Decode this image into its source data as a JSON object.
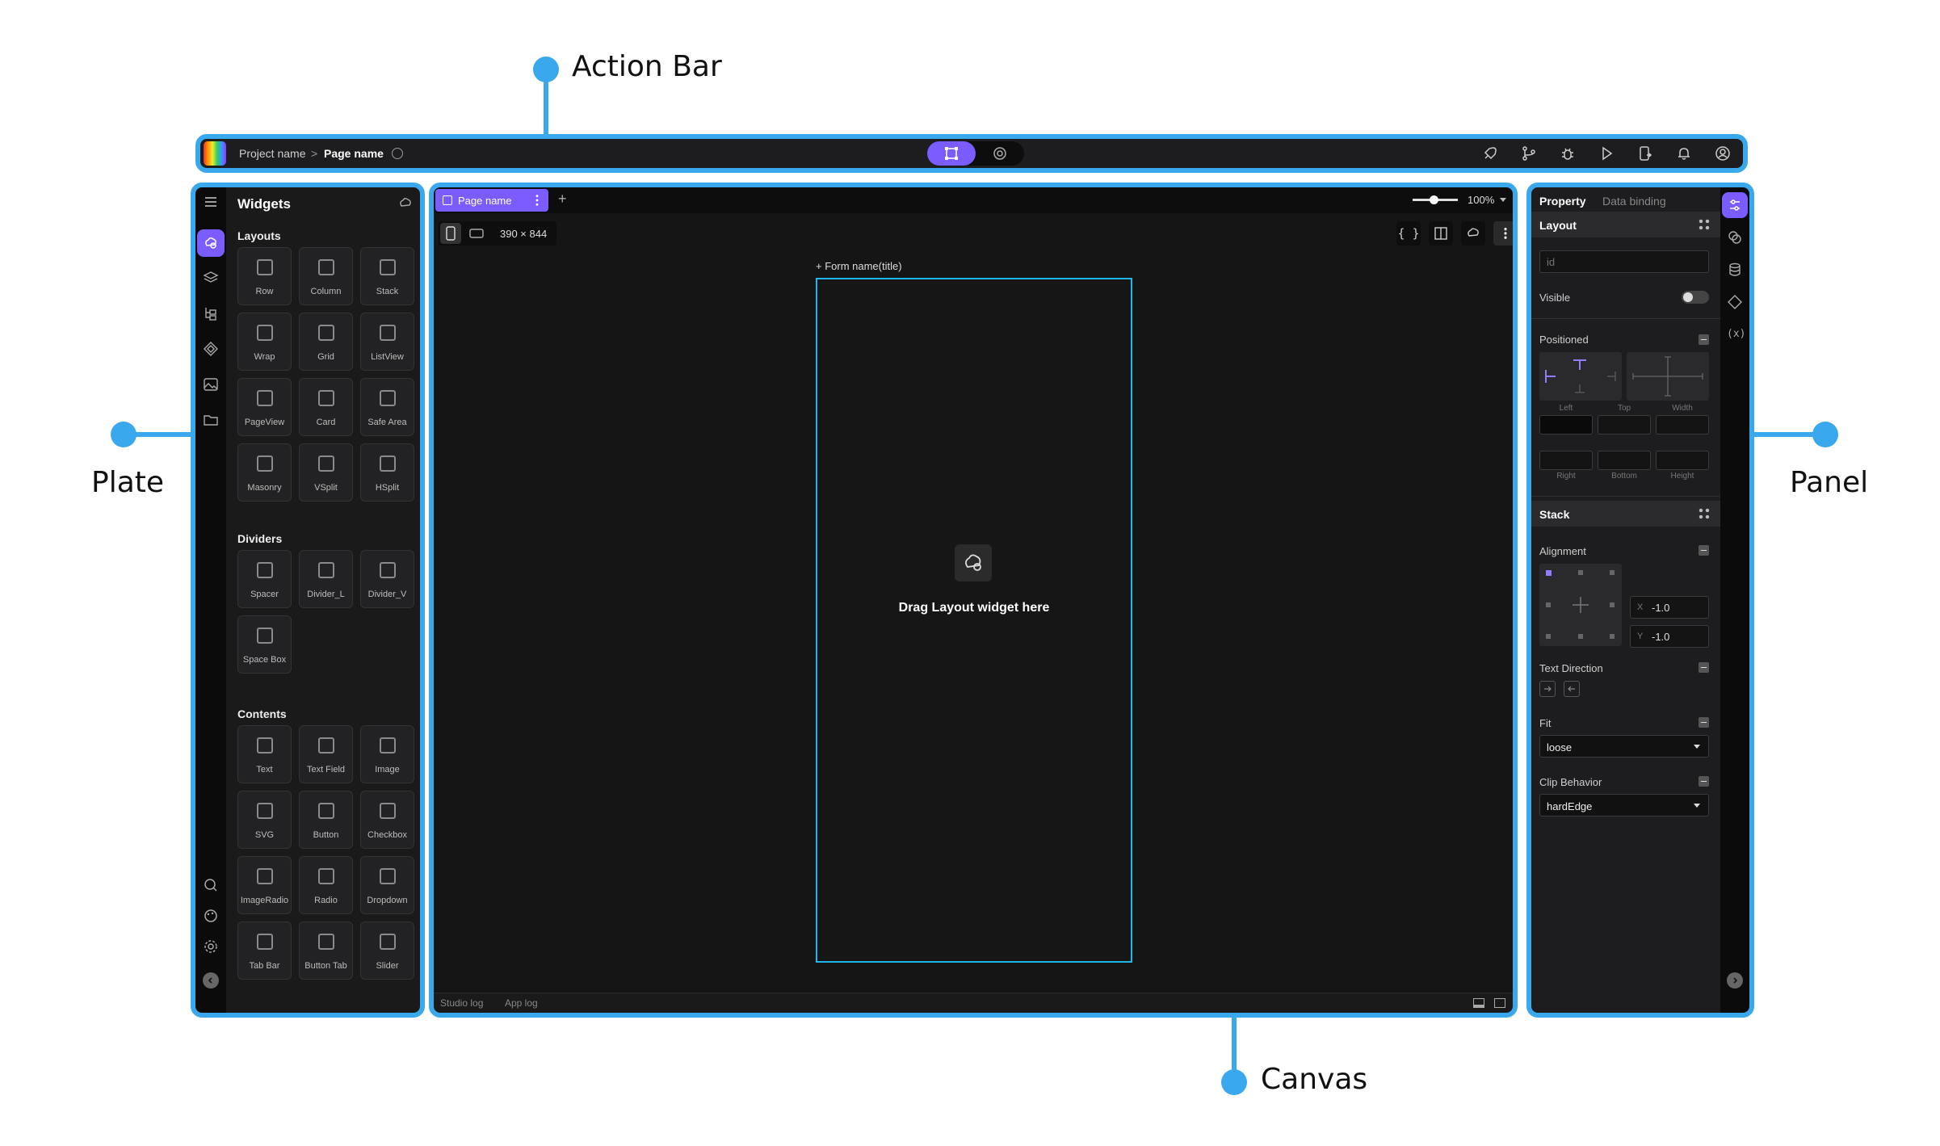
{
  "callouts": {
    "action_bar": "Action Bar",
    "plate": "Plate",
    "canvas": "Canvas",
    "panel": "Panel"
  },
  "colors": {
    "highlight": "#3aa8ec",
    "accent": "#7b5cff",
    "background": "#1a1a1b"
  },
  "action_bar": {
    "breadcrumb": {
      "project": "Project name",
      "separator": ">",
      "page": "Page name"
    },
    "center_toggle": [
      "design-mode-icon",
      "preview-mode-icon"
    ],
    "right_icons": [
      "rocket-icon",
      "branch-icon",
      "bug-icon",
      "play-icon",
      "device-icon",
      "bell-icon",
      "account-icon"
    ]
  },
  "plate": {
    "title": "Widgets",
    "sections": [
      {
        "title": "Layouts",
        "items": [
          "Row",
          "Column",
          "Stack",
          "Wrap",
          "Grid",
          "ListView",
          "PageView",
          "Card",
          "Safe Area",
          "Masonry",
          "VSplit",
          "HSplit"
        ]
      },
      {
        "title": "Dividers",
        "items": [
          "Spacer",
          "Divider_L",
          "Divider_V",
          "Space Box"
        ]
      },
      {
        "title": "Contents",
        "items": [
          "Text",
          "Text Field",
          "Image",
          "SVG",
          "Button",
          "Checkbox",
          "ImageRadio",
          "Radio",
          "Dropdown",
          "Tab Bar",
          "Button Tab",
          "Slider"
        ]
      }
    ]
  },
  "canvas": {
    "tab": "Page name",
    "add_tab": "+",
    "zoom": "100%",
    "device_size": "390 × 844",
    "form_title": "+  Form name(title)",
    "drop_hint": "Drag Layout widget here",
    "logs": [
      "Studio log",
      "App log"
    ]
  },
  "panel": {
    "tabs": [
      "Property",
      "Data binding"
    ],
    "layout": {
      "title": "Layout",
      "id_placeholder": "id",
      "visible_label": "Visible",
      "visible": false
    },
    "positioned": {
      "title": "Positioned",
      "labels_top": [
        "Left",
        "Top",
        "Width"
      ],
      "labels_bottom": [
        "Right",
        "Bottom",
        "Height"
      ]
    },
    "stack": {
      "title": "Stack",
      "alignment": "Alignment",
      "x_label": "X",
      "x_value": "-1.0",
      "y_label": "Y",
      "y_value": "-1.0",
      "text_direction": "Text Direction",
      "fit": "Fit",
      "fit_value": "loose",
      "clip": "Clip Behavior",
      "clip_value": "hardEdge"
    }
  }
}
